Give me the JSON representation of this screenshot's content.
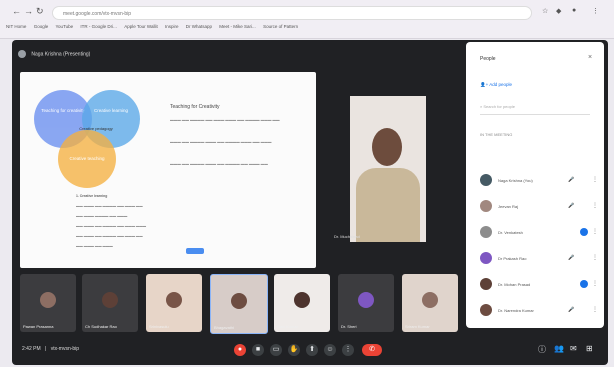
{
  "browser": {
    "url": "meet.google.com/vtx-mvsn-bip",
    "bookmarks": [
      "NIT Home",
      "Google",
      "YouTube",
      "ITR - Google Dri...",
      "Apple Tour Wallit",
      "Inspire",
      "Dr Whatsapp",
      "Meet - Mike Sari...",
      "Source of Pattern"
    ],
    "back": "←",
    "forward": "→",
    "reload": "↻"
  },
  "meeting": {
    "presenter_label": "Naga Krishna (Presenting)",
    "main_speaker": "Dr. Muchhinad",
    "time": "2:42 PM",
    "meeting_code": "vtx-mvsn-bip"
  },
  "slide": {
    "circles": [
      "Teaching for creativity",
      "Creative learning",
      "Creative teaching"
    ],
    "center": "Creative pedagogy",
    "title": "Teaching for Creativity",
    "list_title": "1. Creative learning"
  },
  "tiles": [
    {
      "name": "Pawan Prasanna"
    },
    {
      "name": "Ch Sudhakar Rao"
    },
    {
      "name": "Srinivasulu"
    },
    {
      "name": "Bhagavathi"
    },
    {
      "name": "Ravi Kumar"
    },
    {
      "name": "Dr. Sheri"
    },
    {
      "name": "Sriram Kumar"
    }
  ],
  "people_panel": {
    "title": "People",
    "add_people": "Add people",
    "search_placeholder": "Search for people",
    "section": "IN THE MEETING",
    "participants": [
      {
        "name": "Naga Krishna (You)"
      },
      {
        "name": "Jeevan Raj"
      },
      {
        "name": "Dr. Venkatesh"
      },
      {
        "name": "Dr Prakash Rao"
      },
      {
        "name": "Dr. Mohan Prasad"
      },
      {
        "name": "Dr. Narendra Kumar"
      }
    ]
  },
  "colors": {
    "meet_bg": "#202124",
    "circle_blue": "#5b8def",
    "circle_orange": "#f5b142",
    "end_call": "#ea4335",
    "accent": "#1a73e8"
  }
}
